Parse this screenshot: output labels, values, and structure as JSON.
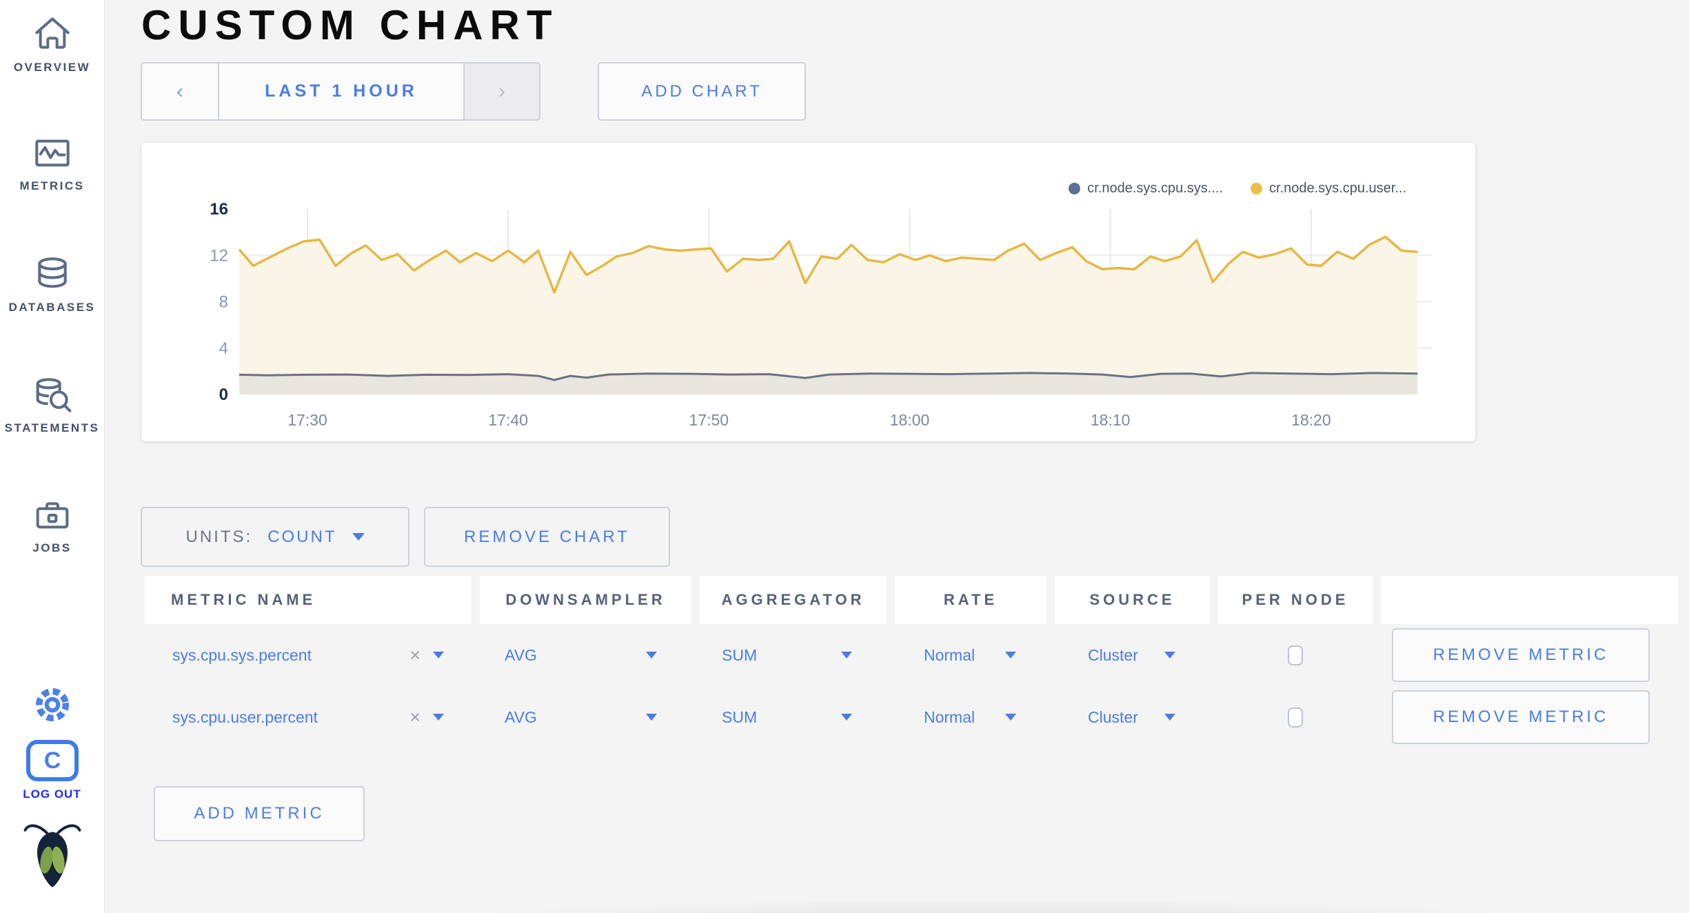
{
  "sidebar": {
    "items": [
      {
        "label": "OVERVIEW",
        "icon": "home-icon"
      },
      {
        "label": "METRICS",
        "icon": "metrics-graph-icon"
      },
      {
        "label": "DATABASES",
        "icon": "database-icon"
      },
      {
        "label": "STATEMENTS",
        "icon": "database-search-icon"
      },
      {
        "label": "JOBS",
        "icon": "briefcase-icon"
      }
    ],
    "logout_label": "LOG OUT"
  },
  "header": {
    "title": "CUSTOM CHART"
  },
  "toolbar": {
    "prev_arrow": "‹",
    "time_range_label": "LAST 1 HOUR",
    "next_arrow": "›",
    "add_chart_label": "ADD CHART"
  },
  "chart_card": {
    "legend": [
      {
        "label": "cr.node.sys.cpu.sys....",
        "color": "#5e6f95"
      },
      {
        "label": "cr.node.sys.cpu.user...",
        "color": "#ecbe4c"
      }
    ]
  },
  "chart_data": {
    "type": "line",
    "title": "",
    "xlabel": "",
    "ylabel": "",
    "x_unit": "minutes-after-17:00",
    "xlim": [
      26.6,
      85.5
    ],
    "ylim": [
      0,
      16
    ],
    "yticks": [
      0,
      4,
      8,
      12,
      16
    ],
    "xticks": [
      {
        "value": 30,
        "label": "17:30"
      },
      {
        "value": 40,
        "label": "17:40"
      },
      {
        "value": 50,
        "label": "17:50"
      },
      {
        "value": 60,
        "label": "18:00"
      },
      {
        "value": 70,
        "label": "18:10"
      },
      {
        "value": 80,
        "label": "18:20"
      }
    ],
    "grid": true,
    "legend_position": "top-right",
    "series": [
      {
        "name": "cr.node.sys.cpu.sys....",
        "color": "#667285",
        "fill": "#e9e6de",
        "points": [
          [
            26.6,
            1.7
          ],
          [
            28,
            1.65
          ],
          [
            30,
            1.7
          ],
          [
            32,
            1.72
          ],
          [
            34,
            1.6
          ],
          [
            36,
            1.7
          ],
          [
            38,
            1.68
          ],
          [
            40,
            1.75
          ],
          [
            41.5,
            1.6
          ],
          [
            42.3,
            1.25
          ],
          [
            43.1,
            1.6
          ],
          [
            43.9,
            1.45
          ],
          [
            45,
            1.72
          ],
          [
            47,
            1.8
          ],
          [
            49,
            1.78
          ],
          [
            51,
            1.72
          ],
          [
            53,
            1.75
          ],
          [
            54.8,
            1.42
          ],
          [
            56,
            1.72
          ],
          [
            58,
            1.8
          ],
          [
            60,
            1.78
          ],
          [
            62,
            1.75
          ],
          [
            64,
            1.8
          ],
          [
            66,
            1.85
          ],
          [
            68,
            1.8
          ],
          [
            69.6,
            1.72
          ],
          [
            71,
            1.5
          ],
          [
            72.5,
            1.78
          ],
          [
            74,
            1.8
          ],
          [
            75.5,
            1.55
          ],
          [
            77,
            1.85
          ],
          [
            79,
            1.8
          ],
          [
            81,
            1.75
          ],
          [
            83,
            1.85
          ],
          [
            85.3,
            1.8
          ]
        ]
      },
      {
        "name": "cr.node.sys.cpu.user...",
        "color": "#e5b845",
        "fill": "#faf5e7",
        "points": [
          [
            26.6,
            12.5
          ],
          [
            27.3,
            11.1
          ],
          [
            28.2,
            11.9
          ],
          [
            29,
            12.6
          ],
          [
            29.8,
            13.2
          ],
          [
            30.6,
            13.35
          ],
          [
            31.4,
            11.1
          ],
          [
            32.2,
            12.2
          ],
          [
            32.9,
            12.85
          ],
          [
            33.7,
            11.6
          ],
          [
            34.5,
            12.1
          ],
          [
            35.3,
            10.7
          ],
          [
            36.1,
            11.6
          ],
          [
            36.9,
            12.4
          ],
          [
            37.6,
            11.4
          ],
          [
            38.4,
            12.2
          ],
          [
            39.2,
            11.5
          ],
          [
            40,
            12.4
          ],
          [
            40.8,
            11.4
          ],
          [
            41.5,
            12.4
          ],
          [
            42.3,
            8.8
          ],
          [
            43.1,
            12.3
          ],
          [
            43.9,
            10.3
          ],
          [
            44.7,
            11.1
          ],
          [
            45.4,
            11.9
          ],
          [
            46.2,
            12.2
          ],
          [
            47,
            12.8
          ],
          [
            47.8,
            12.5
          ],
          [
            48.6,
            12.4
          ],
          [
            49.3,
            12.5
          ],
          [
            50.1,
            12.6
          ],
          [
            50.9,
            10.6
          ],
          [
            51.7,
            11.7
          ],
          [
            52.5,
            11.6
          ],
          [
            53.2,
            11.7
          ],
          [
            54,
            13.2
          ],
          [
            54.8,
            9.6
          ],
          [
            55.6,
            11.9
          ],
          [
            56.4,
            11.7
          ],
          [
            57.1,
            12.9
          ],
          [
            57.9,
            11.6
          ],
          [
            58.7,
            11.4
          ],
          [
            59.5,
            12.1
          ],
          [
            60.3,
            11.6
          ],
          [
            61,
            12.0
          ],
          [
            61.8,
            11.5
          ],
          [
            62.6,
            11.8
          ],
          [
            63.4,
            11.7
          ],
          [
            64.2,
            11.6
          ],
          [
            64.9,
            12.4
          ],
          [
            65.7,
            13.0
          ],
          [
            66.5,
            11.6
          ],
          [
            67.3,
            12.2
          ],
          [
            68.1,
            12.7
          ],
          [
            68.8,
            11.5
          ],
          [
            69.6,
            10.8
          ],
          [
            70.4,
            10.9
          ],
          [
            71.2,
            10.8
          ],
          [
            72,
            11.9
          ],
          [
            72.7,
            11.5
          ],
          [
            73.5,
            11.9
          ],
          [
            74.3,
            13.3
          ],
          [
            75.1,
            9.7
          ],
          [
            75.9,
            11.3
          ],
          [
            76.6,
            12.3
          ],
          [
            77.4,
            11.8
          ],
          [
            78.2,
            12.1
          ],
          [
            79,
            12.6
          ],
          [
            79.8,
            11.2
          ],
          [
            80.5,
            11.1
          ],
          [
            81.3,
            12.3
          ],
          [
            82.1,
            11.7
          ],
          [
            82.9,
            12.9
          ],
          [
            83.7,
            13.6
          ],
          [
            84.5,
            12.4
          ],
          [
            85.3,
            12.3
          ]
        ]
      }
    ]
  },
  "chart_controls": {
    "units_label": "UNITS:",
    "units_value": "COUNT",
    "remove_chart_label": "REMOVE CHART",
    "add_metric_label": "ADD METRIC"
  },
  "metrics_table": {
    "columns": [
      "METRIC NAME",
      "DOWNSAMPLER",
      "AGGREGATOR",
      "RATE",
      "SOURCE",
      "PER NODE",
      ""
    ],
    "clear_glyph": "×",
    "rows": [
      {
        "metric_name": "sys.cpu.sys.percent",
        "downsampler": "AVG",
        "aggregator": "SUM",
        "rate": "Normal",
        "source": "Cluster",
        "per_node_checked": false,
        "remove_label": "REMOVE METRIC"
      },
      {
        "metric_name": "sys.cpu.user.percent",
        "downsampler": "AVG",
        "aggregator": "SUM",
        "rate": "Normal",
        "source": "Cluster",
        "per_node_checked": false,
        "remove_label": "REMOVE METRIC"
      }
    ]
  }
}
